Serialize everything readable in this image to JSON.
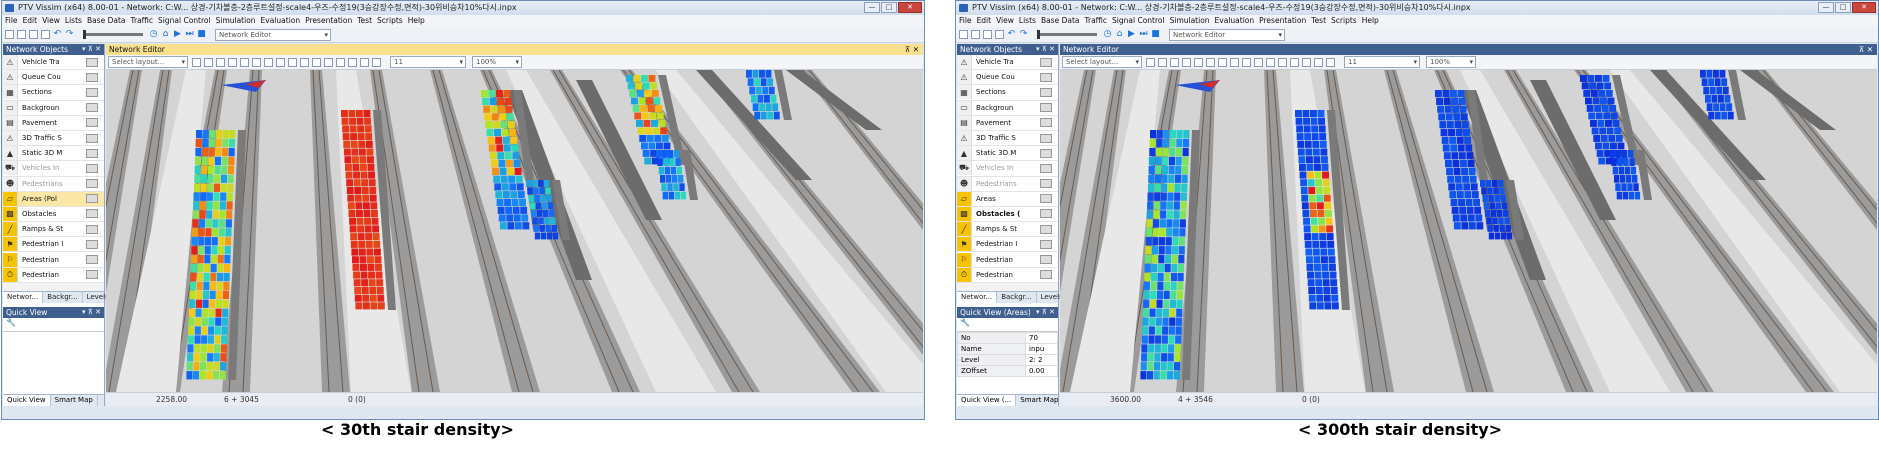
{
  "colors": {
    "title_active": "#3f5f8e",
    "editor_header_active": "#f9e08f",
    "area_selected": "#f8c300",
    "density_low": "#0a2bd8",
    "density_high": "#e01b1b"
  },
  "menu": [
    "File",
    "Edit",
    "View",
    "Lists",
    "Base Data",
    "Traffic",
    "Signal Control",
    "Simulation",
    "Evaluation",
    "Presentation",
    "Test",
    "Scripts",
    "Help"
  ],
  "windows": [
    {
      "title": "PTV Vissim (x64) 8.00-01 - Network: C:W... 상경-기차볼층-2층루트설정-scale4-우즈-수정19(3승강장수정,면적)-30위비승차10%다시.inpx",
      "network_editor_combo": "Network Editor",
      "network_objects_title": "Network Objects",
      "network_editor_title": "Network Editor",
      "layout_placeholder": "Select layout...",
      "level_value": "11",
      "zoom_value": "100%",
      "objects": [
        {
          "label": "Vehicle Tra",
          "icon": "vehicle-travel-time-icon",
          "state": "normal"
        },
        {
          "label": "Queue Cou",
          "icon": "queue-counter-icon",
          "state": "normal"
        },
        {
          "label": "Sections",
          "icon": "sections-icon",
          "state": "normal"
        },
        {
          "label": "Backgroun",
          "icon": "background-icon",
          "state": "normal"
        },
        {
          "label": "Pavement",
          "icon": "pavement-icon",
          "state": "normal"
        },
        {
          "label": "3D Traffic S",
          "icon": "traffic-signal-icon",
          "state": "normal"
        },
        {
          "label": "Static 3D M",
          "icon": "static-3d-model-icon",
          "state": "normal"
        },
        {
          "label": "Vehicles In",
          "icon": "vehicles-in-network-icon",
          "state": "dim"
        },
        {
          "label": "Pedestrians",
          "icon": "pedestrians-icon",
          "state": "dim"
        },
        {
          "label": "Areas (Pol",
          "icon": "areas-icon",
          "state": "selected"
        },
        {
          "label": "Obstacles",
          "icon": "obstacles-icon",
          "state": "normal"
        },
        {
          "label": "Ramps & St",
          "icon": "ramps-stairs-icon",
          "state": "normal"
        },
        {
          "label": "Pedestrian I",
          "icon": "pedestrian-input-icon",
          "state": "normal"
        },
        {
          "label": "Pedestrian",
          "icon": "pedestrian-route-icon",
          "state": "normal"
        },
        {
          "label": "Pedestrian",
          "icon": "pedestrian-travel-time-icon",
          "state": "normal"
        }
      ],
      "panel_tabs": [
        "Networ...",
        "Backgr...",
        "Levels"
      ],
      "quick_view_title": "Quick View",
      "quick_view_rows": [],
      "quick_view_tabs": [
        "Quick View",
        "Smart Map"
      ],
      "status": {
        "coords": "2258.00",
        "scale": "6 + 3045",
        "time": "0 (0)"
      },
      "caption": "< 30th stair density>",
      "stairs_mode": "early"
    },
    {
      "title": "PTV Vissim (x64) 8.00-01 - Network: C:W... 상경-기차볼층-2층루트설정-scale4-우즈-수정19(3승강장수정,면적)-30위비승차10%다시.inpx",
      "network_editor_combo": "Network Editor",
      "network_objects_title": "Network Objects",
      "network_editor_title": "Network Editor",
      "layout_placeholder": "Select layout...",
      "level_value": "11",
      "zoom_value": "100%",
      "objects": [
        {
          "label": "Vehicle Tra",
          "icon": "vehicle-travel-time-icon",
          "state": "normal"
        },
        {
          "label": "Queue Cou",
          "icon": "queue-counter-icon",
          "state": "normal"
        },
        {
          "label": "Sections",
          "icon": "sections-icon",
          "state": "normal"
        },
        {
          "label": "Backgroun",
          "icon": "background-icon",
          "state": "normal"
        },
        {
          "label": "Pavement",
          "icon": "pavement-icon",
          "state": "normal"
        },
        {
          "label": "3D Traffic S",
          "icon": "traffic-signal-icon",
          "state": "normal"
        },
        {
          "label": "Static 3D M",
          "icon": "static-3d-model-icon",
          "state": "normal"
        },
        {
          "label": "Vehicles In",
          "icon": "vehicles-in-network-icon",
          "state": "dim"
        },
        {
          "label": "Pedestrians",
          "icon": "pedestrians-icon",
          "state": "dim"
        },
        {
          "label": "Areas",
          "icon": "areas-icon",
          "state": "normal"
        },
        {
          "label": "Obstacles (",
          "icon": "obstacles-icon",
          "state": "bold"
        },
        {
          "label": "Ramps & St",
          "icon": "ramps-stairs-icon",
          "state": "normal"
        },
        {
          "label": "Pedestrian I",
          "icon": "pedestrian-input-icon",
          "state": "normal"
        },
        {
          "label": "Pedestrian",
          "icon": "pedestrian-route-icon",
          "state": "normal"
        },
        {
          "label": "Pedestrian",
          "icon": "pedestrian-travel-time-icon",
          "state": "normal"
        }
      ],
      "panel_tabs": [
        "Networ...",
        "Backgr...",
        "Levels"
      ],
      "quick_view_title": "Quick View (Areas)",
      "quick_view_rows": [
        {
          "key": "No",
          "value": "70"
        },
        {
          "key": "Name",
          "value": "inpu"
        },
        {
          "key": "Level",
          "value": "2: 2"
        },
        {
          "key": "ZOffset",
          "value": "0.00"
        }
      ],
      "quick_view_tabs": [
        "Quick View (...",
        "Smart Map"
      ],
      "status": {
        "coords": "3600.00",
        "scale": "4 + 3546",
        "time": "0 (0)"
      },
      "caption": "< 300th stair density>",
      "stairs_mode": "late"
    }
  ]
}
